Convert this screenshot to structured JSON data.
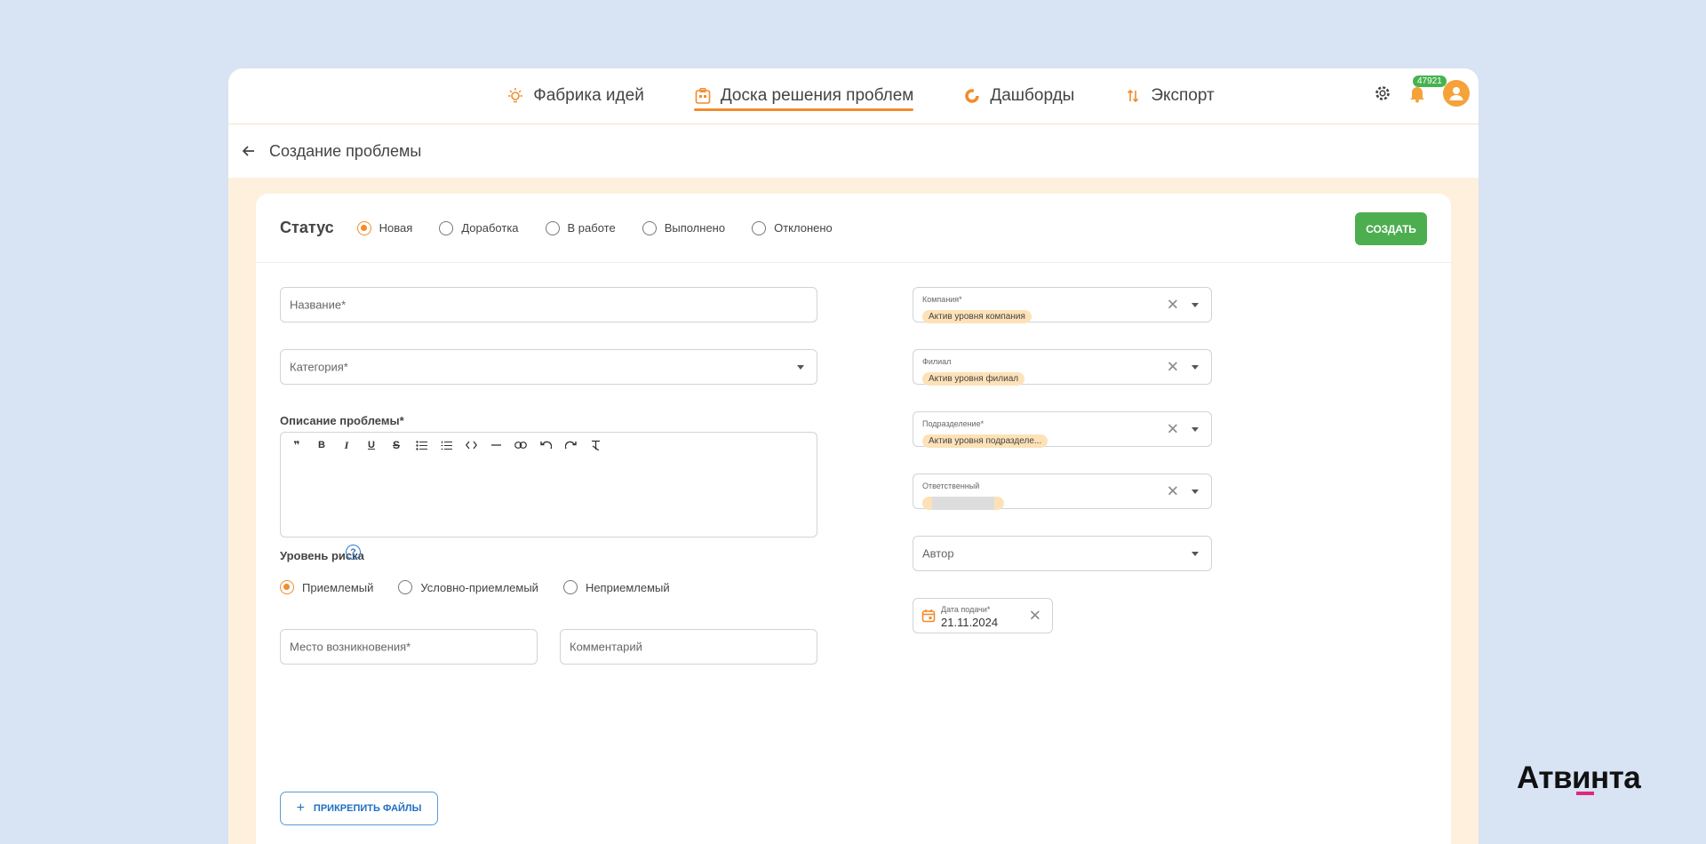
{
  "nav": {
    "items": [
      {
        "label": "Фабрика идей",
        "icon": "lightbulb-icon"
      },
      {
        "label": "Доска решения проблем",
        "icon": "board-icon",
        "active": true
      },
      {
        "label": "Дашборды",
        "icon": "pie-chart-icon"
      },
      {
        "label": "Экспорт",
        "icon": "sort-arrows-icon"
      }
    ],
    "notifications_badge": "47921",
    "accent_color": "#f28b2c"
  },
  "breadcrumb": {
    "title": "Создание проблемы"
  },
  "status": {
    "label": "Статус",
    "options": [
      "Новая",
      "Доработка",
      "В работе",
      "Выполнено",
      "Отклонено"
    ],
    "selected": "Новая",
    "create_button": "СОЗДАТЬ"
  },
  "form": {
    "name_placeholder": "Название*",
    "category_placeholder": "Категория*",
    "description_label": "Описание проблемы*",
    "risk_label": "Уровень риска",
    "risk_options": [
      "Приемлемый",
      "Условно-приемлемый",
      "Неприемлемый"
    ],
    "risk_selected": "Приемлемый",
    "place_placeholder": "Место возникновения*",
    "comment_placeholder": "Комментарий",
    "attach_button": "ПРИКРЕПИТЬ ФАЙЛЫ"
  },
  "side": {
    "company": {
      "label": "Компания*",
      "value": "Актив уровня компания"
    },
    "branch": {
      "label": "Филиал",
      "value": "Актив уровня филиал"
    },
    "division": {
      "label": "Подразделение*",
      "value": "Актив уровня подразделе..."
    },
    "responsible": {
      "label": "Ответственный",
      "value": ""
    },
    "author_placeholder": "Автор",
    "date": {
      "label": "Дата подачи*",
      "value": "21.11.2024"
    }
  },
  "brand": {
    "logo_text": "Атвинта"
  }
}
